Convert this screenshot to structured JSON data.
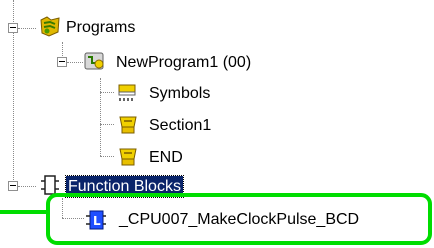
{
  "tree": {
    "programs": {
      "label": "Programs",
      "icon": "programs-folder-icon",
      "expanded": true
    },
    "program": {
      "label": "NewProgram1 (00)",
      "icon": "program-icon",
      "expanded": true
    },
    "symbols": {
      "label": "Symbols",
      "icon": "symbols-icon"
    },
    "section": {
      "label": "Section1",
      "icon": "section-icon"
    },
    "end": {
      "label": "END",
      "icon": "end-section-icon"
    },
    "function_blocks": {
      "label": "Function Blocks",
      "icon": "function-blocks-icon",
      "expanded": true,
      "selected": true
    },
    "fb_item": {
      "label": "_CPU007_MakeClockPulse_BCD",
      "icon": "function-block-icon"
    }
  },
  "colors": {
    "highlight": "#00dd00",
    "selection": "#0a246a",
    "yellow_icon": "#f0d000"
  }
}
